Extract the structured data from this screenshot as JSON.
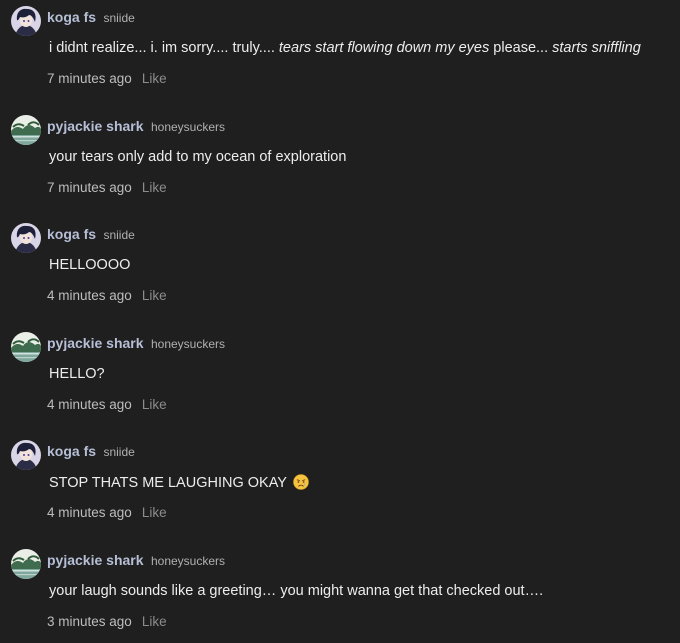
{
  "comments": [
    {
      "avatar": "anime-boy-avatar",
      "display_name": "koga fs",
      "handle": "sniide",
      "body": {
        "plain": "i didnt realize... i. im sorry.... truly.... ",
        "italic1": "tears start flowing down my eyes",
        "plain2": " please... ",
        "italic2": "starts sniffling"
      },
      "timestamp": "7 minutes ago",
      "like": "Like"
    },
    {
      "avatar": "landscape-avatar",
      "display_name": "pyjackie shark",
      "handle": "honeysuckers",
      "body": {
        "plain": "your tears only add to my ocean of exploration"
      },
      "timestamp": "7 minutes ago",
      "like": "Like"
    },
    {
      "avatar": "anime-boy-avatar",
      "display_name": "koga fs",
      "handle": "sniide",
      "body": {
        "plain": "HELLOOOO"
      },
      "timestamp": "4 minutes ago",
      "like": "Like"
    },
    {
      "avatar": "landscape-avatar",
      "display_name": "pyjackie shark",
      "handle": "honeysuckers",
      "body": {
        "plain": "HELLO?"
      },
      "timestamp": "4 minutes ago",
      "like": "Like"
    },
    {
      "avatar": "anime-boy-avatar",
      "display_name": "koga fs",
      "handle": "sniide",
      "body": {
        "plain": "STOP THATS ME LAUGHING OKAY ",
        "emoji": "crying-face-emoji"
      },
      "timestamp": "4 minutes ago",
      "like": "Like"
    },
    {
      "avatar": "landscape-avatar",
      "display_name": "pyjackie shark",
      "handle": "honeysuckers",
      "body": {
        "plain": "your laugh sounds like a greeting… you might wanna get that checked out…."
      },
      "timestamp": "3 minutes ago",
      "like": "Like"
    }
  ],
  "colors": {
    "background": "#1f1f20",
    "username": "#b7bfd6",
    "text": "#ededed",
    "muted": "#8c8c8c"
  }
}
